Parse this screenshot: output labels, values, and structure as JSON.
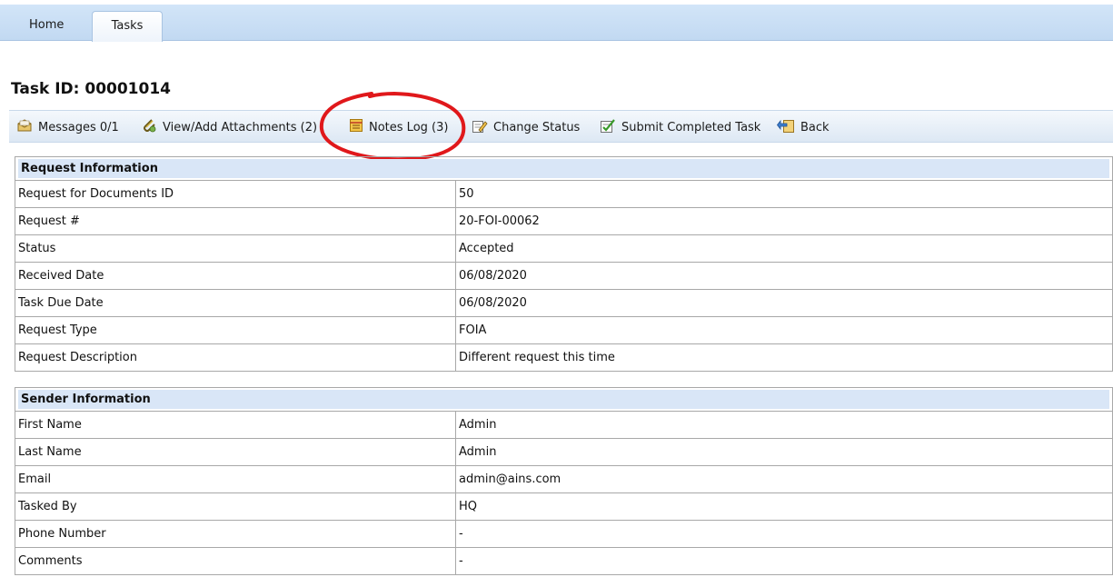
{
  "tabs": [
    {
      "label": "Home",
      "active": false
    },
    {
      "label": "Tasks",
      "active": true
    }
  ],
  "page": {
    "title": "Task ID: 00001014"
  },
  "toolbar": {
    "messages_label": "Messages 0/1",
    "attachments_label": "View/Add Attachments (2)",
    "notes_label": "Notes Log (3)",
    "change_status_label": "Change Status",
    "submit_label": "Submit Completed Task",
    "back_label": "Back"
  },
  "request_info": {
    "heading": "Request Information",
    "rows": [
      {
        "label": "Request for Documents ID",
        "value": "50"
      },
      {
        "label": "Request #",
        "value": "20-FOI-00062"
      },
      {
        "label": "Status",
        "value": "Accepted"
      },
      {
        "label": "Received Date",
        "value": "06/08/2020"
      },
      {
        "label": "Task Due Date",
        "value": "06/08/2020"
      },
      {
        "label": "Request Type",
        "value": "FOIA"
      },
      {
        "label": "Request Description",
        "value": "Different request this time"
      }
    ]
  },
  "sender_info": {
    "heading": "Sender Information",
    "rows": [
      {
        "label": "First Name",
        "value": "Admin"
      },
      {
        "label": "Last Name",
        "value": "Admin"
      },
      {
        "label": "Email",
        "value": "admin@ains.com"
      },
      {
        "label": "Tasked By",
        "value": "HQ"
      },
      {
        "label": "Phone Number",
        "value": "-"
      },
      {
        "label": "Comments",
        "value": "-"
      }
    ]
  },
  "colors": {
    "tabbar": "#c7dcf4",
    "section_header": "#d9e6f7",
    "highlight_ring": "#e0181b"
  },
  "icons": [
    "messages-icon",
    "attachment-icon",
    "notes-log-icon",
    "change-status-icon",
    "submit-task-icon",
    "back-icon"
  ]
}
